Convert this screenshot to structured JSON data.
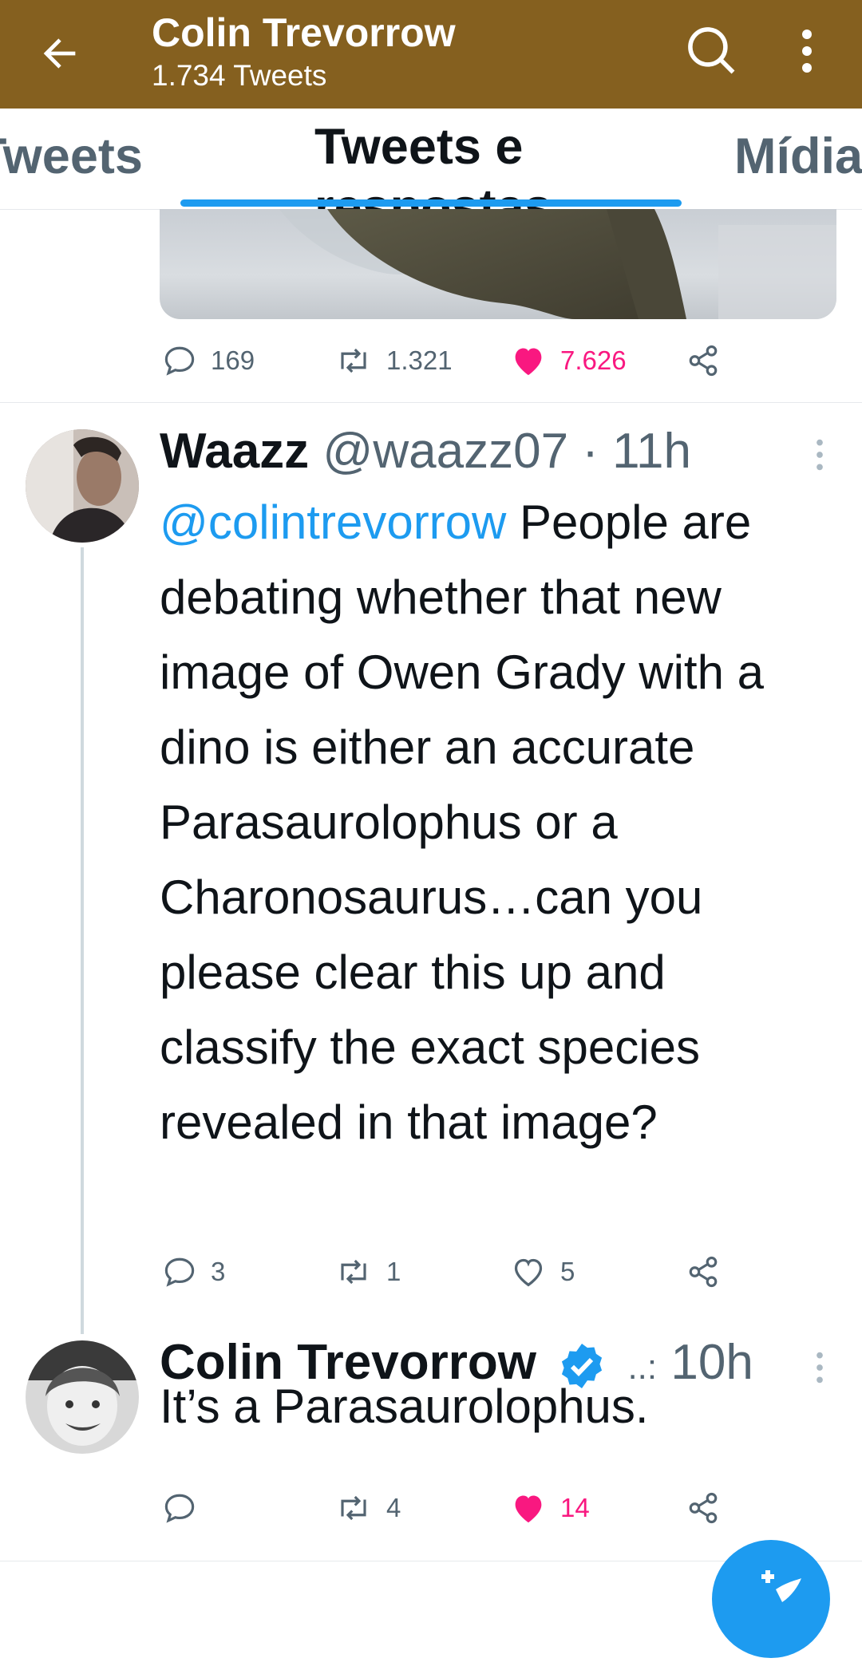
{
  "header": {
    "title": "Colin Trevorrow",
    "subtitle": "1.734 Tweets",
    "bg_color": "#85601f",
    "icons": [
      "arrow-left-icon",
      "search-icon",
      "more-vertical-icon"
    ]
  },
  "tabs": [
    {
      "label": "Tweets"
    },
    {
      "label": "Tweets e respostas",
      "selected": true
    },
    {
      "label": "Mídia"
    }
  ],
  "first_tweet": {
    "replies": "169",
    "retweets": "1.321",
    "likes": "7.626",
    "liked": true
  },
  "tweets": [
    {
      "name": "Waazz",
      "handle": "@waazz07",
      "time": "· 11h",
      "mention": "@colintrevorrow",
      "text": " People are debating whether that new image of Owen Grady with a dino is either an accurate Parasaurolophus or a Charonosaurus…can you please clear this up and classify the exact species revealed in that image?",
      "replies": "3",
      "retweets": "1",
      "likes": "5",
      "liked": false
    },
    {
      "name": "Colin Trevorrow",
      "verified": true,
      "handle_truncated": "..:",
      "time": "10h",
      "text": "It’s a Parasaurolophus.",
      "replies": "",
      "retweets": "4",
      "likes": "14",
      "liked": true
    }
  ],
  "colors": {
    "accent": "#1d9bf0",
    "like": "#f91880",
    "muted": "#536471"
  }
}
